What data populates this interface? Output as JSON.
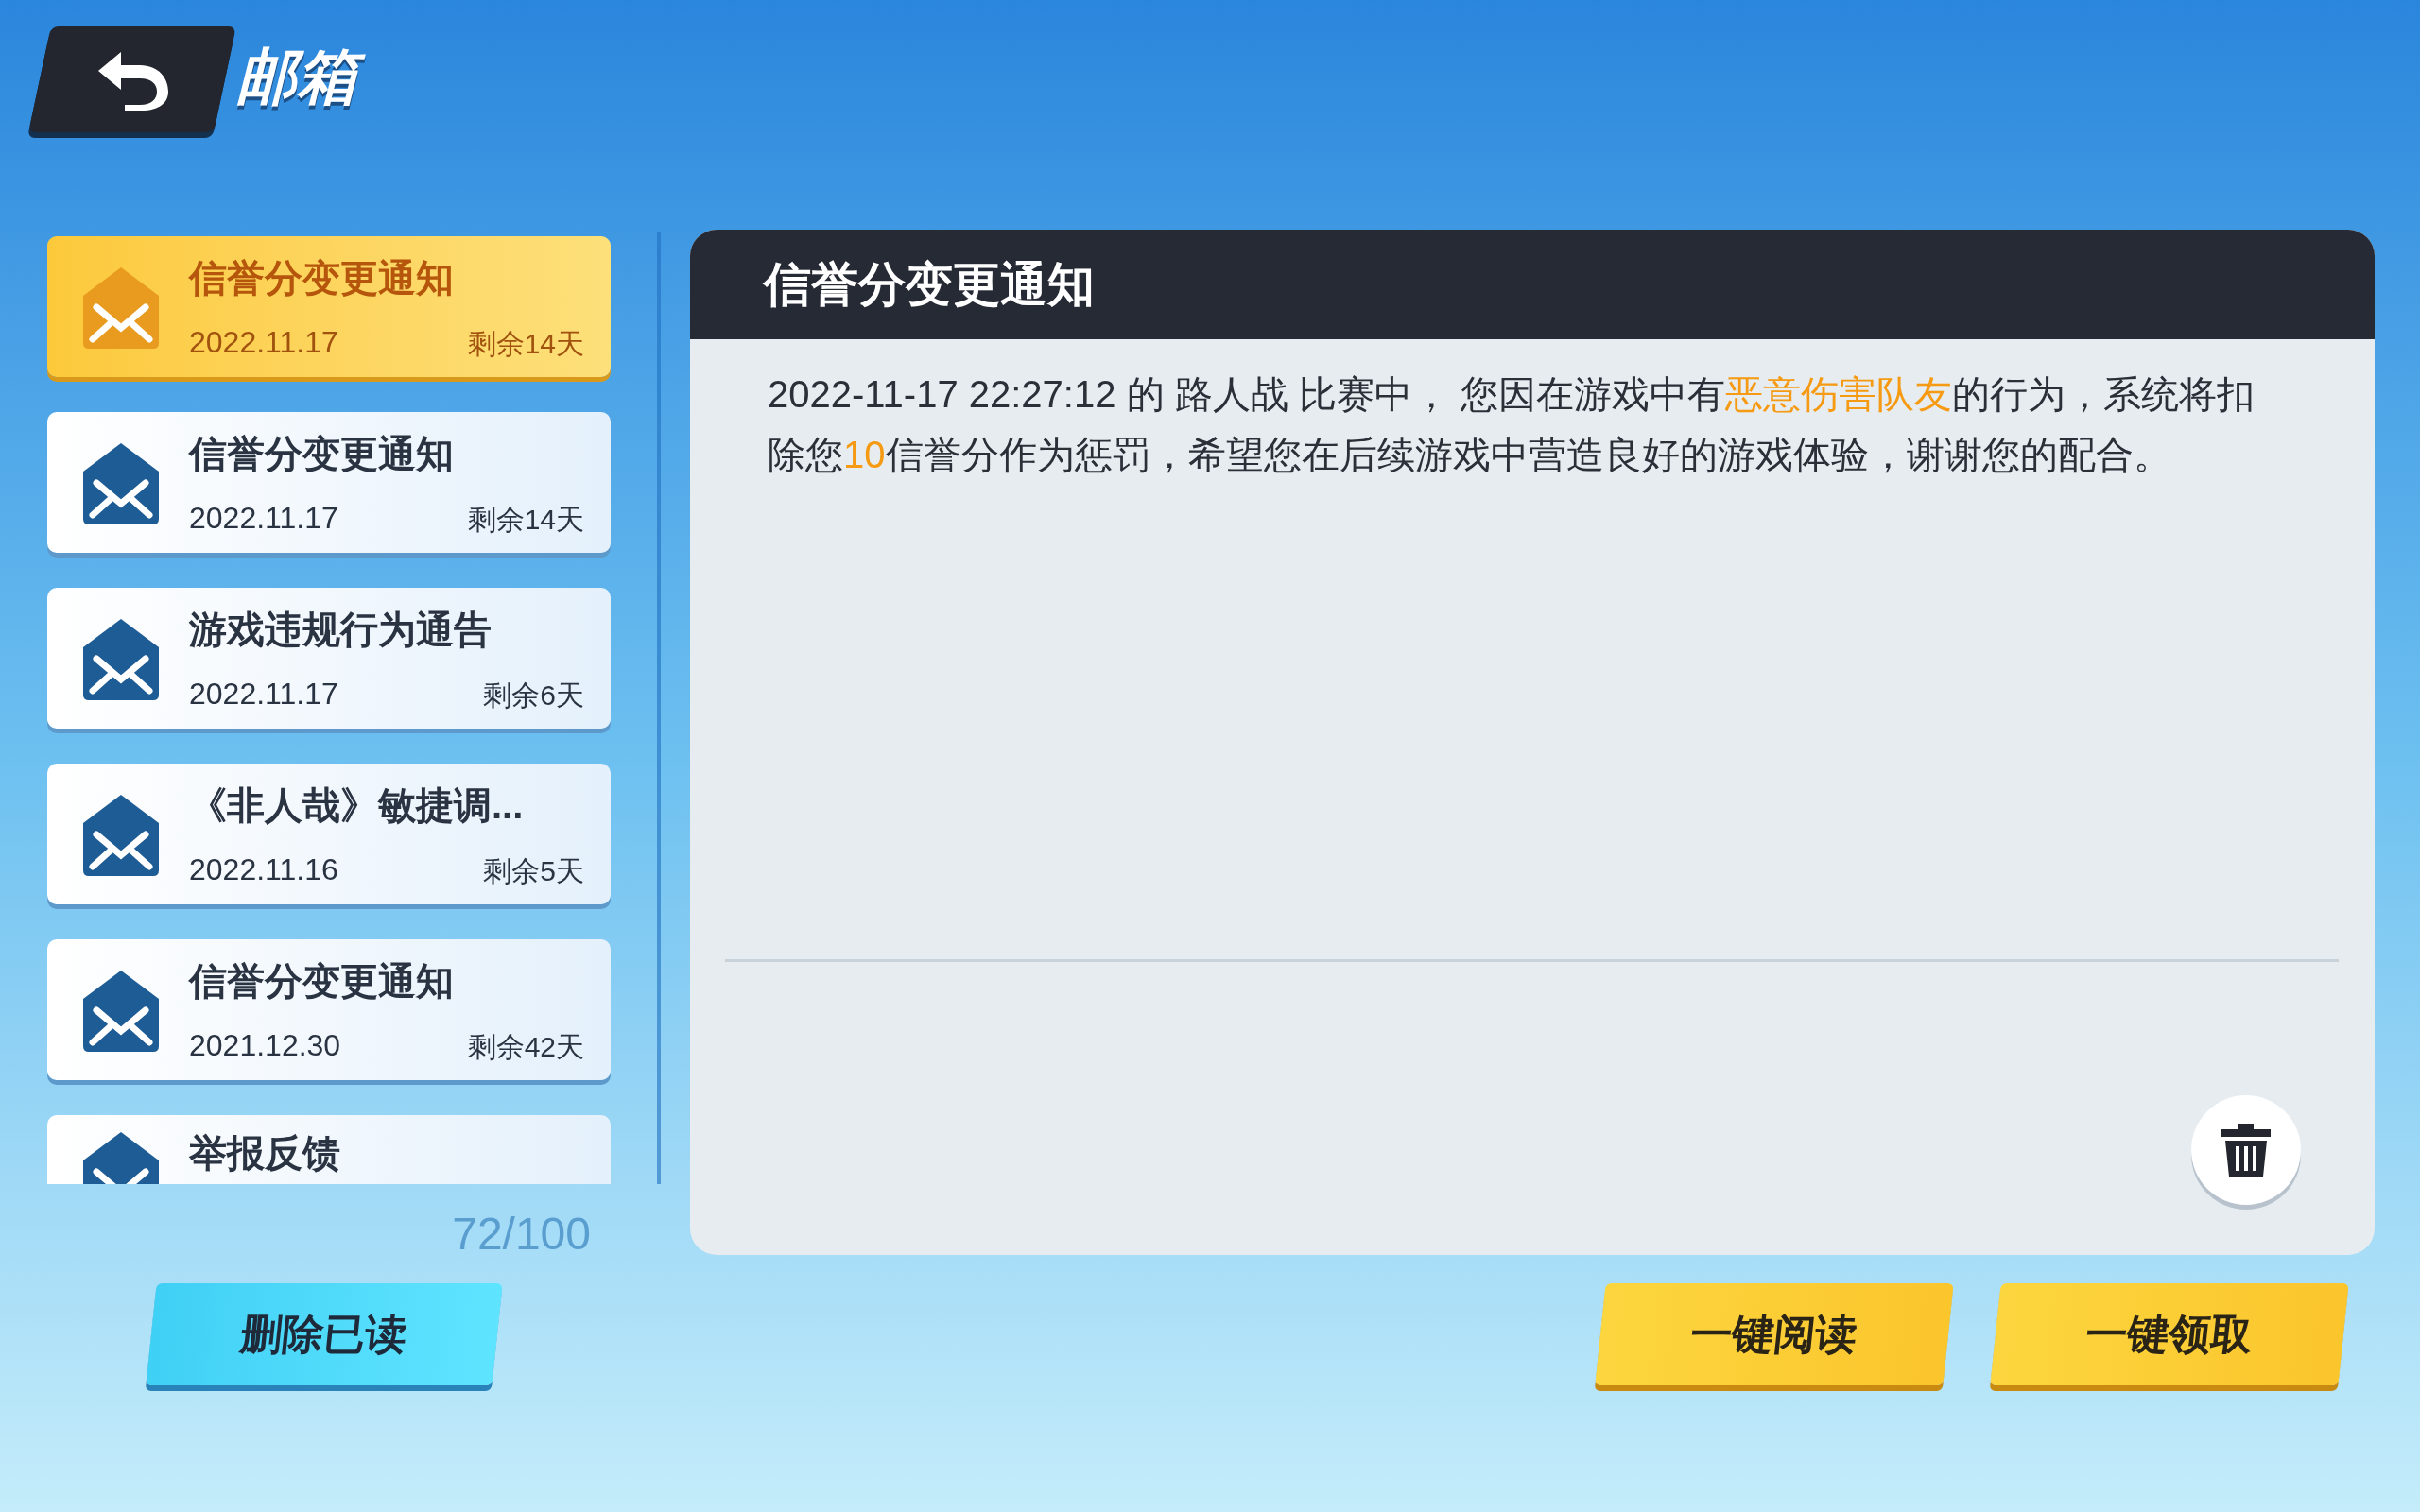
{
  "header": {
    "title": "邮箱"
  },
  "mails": [
    {
      "title": "信誉分变更通知",
      "date": "2022.11.17",
      "remaining": "剩余14天",
      "selected": true
    },
    {
      "title": "信誉分变更通知",
      "date": "2022.11.17",
      "remaining": "剩余14天",
      "selected": false
    },
    {
      "title": "游戏违规行为通告",
      "date": "2022.11.17",
      "remaining": "剩余6天",
      "selected": false
    },
    {
      "title": "《非人哉》敏捷调...",
      "date": "2022.11.16",
      "remaining": "剩余5天",
      "selected": false
    },
    {
      "title": "信誉分变更通知",
      "date": "2021.12.30",
      "remaining": "剩余42天",
      "selected": false
    },
    {
      "title": "举报反馈",
      "selected": false
    }
  ],
  "mail_count": "72/100",
  "delete_read_button": "删除已读",
  "detail": {
    "title": "信誉分变更通知",
    "body": [
      {
        "text": "2022-11-17 22:27:12 的 路人战 比赛中， 您因在游戏中有",
        "highlight": false
      },
      {
        "text": "恶意伤害队友",
        "highlight": true
      },
      {
        "text": "的行为，系统将扣除您",
        "highlight": false
      },
      {
        "text": "10",
        "highlight": true
      },
      {
        "text": "信誉分作为惩罚，希望您在后续游戏中营造良好的游戏体验，谢谢您的配合。",
        "highlight": false
      }
    ]
  },
  "action_buttons": [
    "一键阅读",
    "一键领取"
  ]
}
